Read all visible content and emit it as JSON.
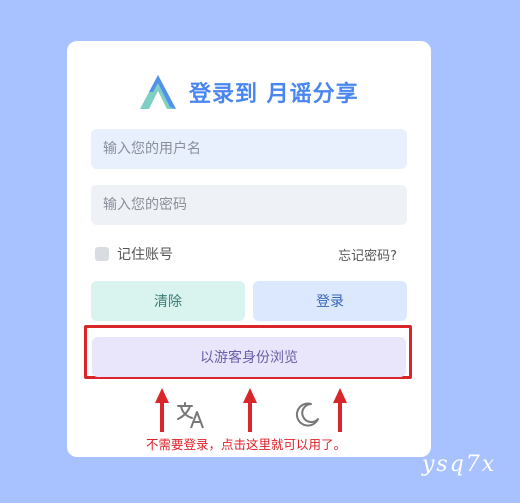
{
  "colors": {
    "background": "#a8c1ff",
    "card": "#ffffff",
    "brand_blue": "#4a86f0",
    "annotation_red": "#d9262a"
  },
  "brand": {
    "logo_icon": "a-shape-logo-icon",
    "title": "登录到 月谣分享"
  },
  "form": {
    "username_placeholder": "输入您的用户名",
    "password_placeholder": "输入您的密码",
    "remember_label": "记住账号",
    "forgot_link": "忘记密码?"
  },
  "buttons": {
    "clear": "清除",
    "login": "登录",
    "guest": "以游客身份浏览"
  },
  "icons": {
    "translate": "translate-icon",
    "theme": "moon-icon"
  },
  "annotation": {
    "note": "不需要登录，点击这里就可以用了。"
  },
  "watermark": "ysq7x"
}
